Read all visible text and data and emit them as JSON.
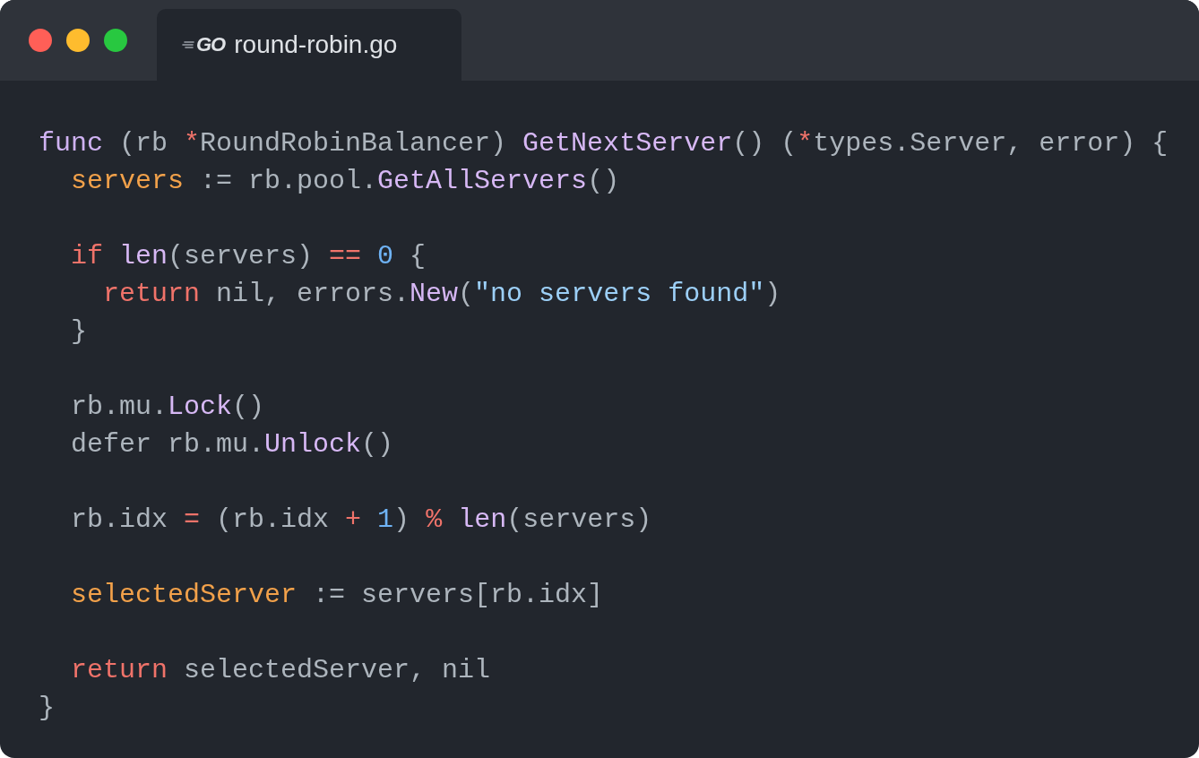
{
  "window": {
    "controls": [
      {
        "color": "#ff5f57"
      },
      {
        "color": "#febc2e"
      },
      {
        "color": "#28c840"
      }
    ]
  },
  "tab": {
    "logo_text": "GO",
    "label": "round-robin.go",
    "selected": true
  },
  "code": {
    "lines": [
      {
        "kind": "code",
        "tokens": [
          {
            "kind": "keyword",
            "text": "func"
          },
          {
            "kind": "plain",
            "text": " (rb "
          },
          {
            "kind": "operator",
            "text": "*"
          },
          {
            "kind": "plain",
            "text": "RoundRobinBalancer) "
          },
          {
            "kind": "function",
            "text": "GetNextServer"
          },
          {
            "kind": "plain",
            "text": "() ("
          },
          {
            "kind": "operator",
            "text": "*"
          },
          {
            "kind": "plain",
            "text": "types.Server, error) {"
          }
        ],
        "children": [
          {
            "kind": "code",
            "tokens": [
              {
                "kind": "variable",
                "text": "servers"
              },
              {
                "kind": "plain",
                "text": " := rb.pool."
              },
              {
                "kind": "function",
                "text": "GetAllServers"
              },
              {
                "kind": "plain",
                "text": "()"
              }
            ]
          },
          {
            "kind": "blank"
          },
          {
            "kind": "code",
            "tokens": [
              {
                "kind": "operator",
                "text": "if"
              },
              {
                "kind": "function",
                "text": " len"
              },
              {
                "kind": "plain",
                "text": "(servers) "
              },
              {
                "kind": "operator",
                "text": "=="
              },
              {
                "kind": "number",
                "text": " 0"
              },
              {
                "kind": "plain",
                "text": " {"
              }
            ],
            "children": [
              {
                "kind": "code",
                "tokens": [
                  {
                    "kind": "operator",
                    "text": "return"
                  },
                  {
                    "kind": "plain",
                    "text": " nil, errors."
                  },
                  {
                    "kind": "function",
                    "text": "New"
                  },
                  {
                    "kind": "plain",
                    "text": "("
                  },
                  {
                    "kind": "string",
                    "text": "\"no servers found\""
                  },
                  {
                    "kind": "plain",
                    "text": ")"
                  }
                ]
              }
            ]
          },
          {
            "kind": "code",
            "tokens": [
              {
                "kind": "plain",
                "text": "}"
              }
            ]
          },
          {
            "kind": "blank"
          },
          {
            "kind": "code",
            "tokens": [
              {
                "kind": "plain",
                "text": "rb.mu."
              },
              {
                "kind": "function",
                "text": "Lock"
              },
              {
                "kind": "plain",
                "text": "()"
              }
            ]
          },
          {
            "kind": "code",
            "tokens": [
              {
                "kind": "plain",
                "text": "defer rb.mu."
              },
              {
                "kind": "function",
                "text": "Unlock"
              },
              {
                "kind": "plain",
                "text": "()"
              }
            ]
          },
          {
            "kind": "blank"
          },
          {
            "kind": "code",
            "tokens": [
              {
                "kind": "plain",
                "text": "rb.idx "
              },
              {
                "kind": "operator",
                "text": "="
              },
              {
                "kind": "plain",
                "text": " (rb.idx "
              },
              {
                "kind": "operator",
                "text": "+"
              },
              {
                "kind": "number",
                "text": " 1"
              },
              {
                "kind": "plain",
                "text": ") "
              },
              {
                "kind": "operator",
                "text": "%"
              },
              {
                "kind": "function",
                "text": " len"
              },
              {
                "kind": "plain",
                "text": "(servers)"
              }
            ]
          },
          {
            "kind": "blank"
          },
          {
            "kind": "code",
            "tokens": [
              {
                "kind": "variable",
                "text": "selectedServer"
              },
              {
                "kind": "plain",
                "text": " := servers[rb.idx]"
              }
            ]
          },
          {
            "kind": "blank"
          },
          {
            "kind": "code",
            "tokens": [
              {
                "kind": "operator",
                "text": "return"
              },
              {
                "kind": "plain",
                "text": " selectedServer, nil"
              }
            ]
          }
        ]
      },
      {
        "kind": "code",
        "tokens": [
          {
            "kind": "plain",
            "text": "}"
          }
        ]
      }
    ]
  }
}
